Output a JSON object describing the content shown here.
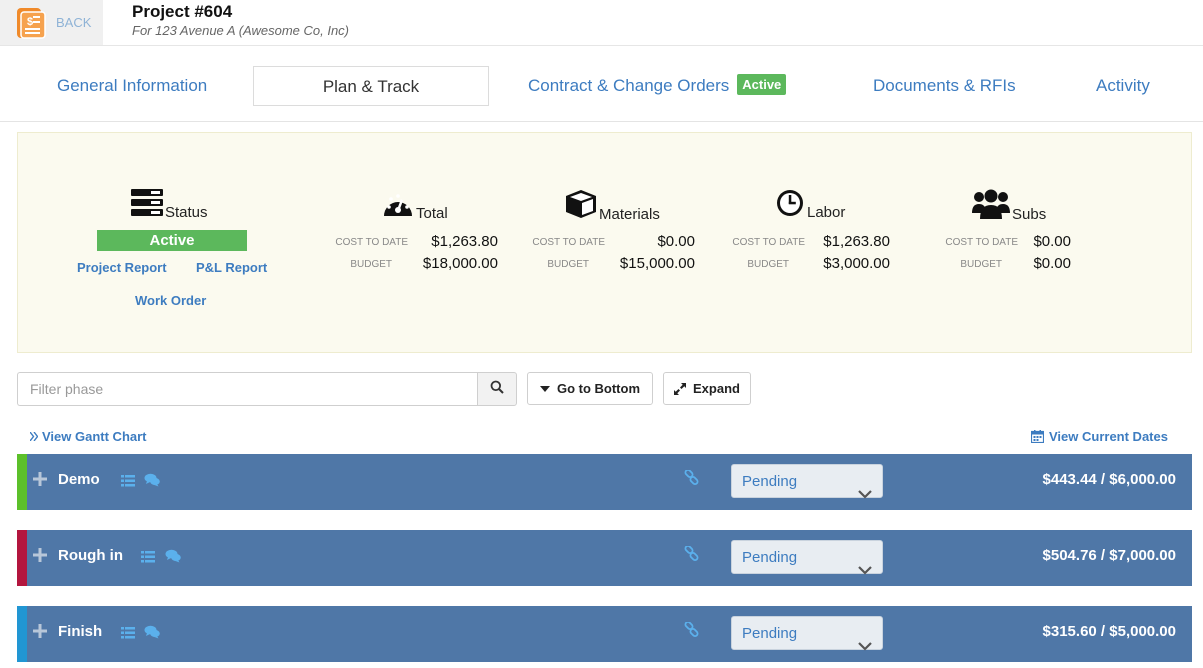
{
  "header": {
    "back_label": "BACK",
    "project_title": "Project #604",
    "project_subtitle": "For 123 Avenue A (Awesome Co, Inc)"
  },
  "tabs": [
    {
      "label": "General Information"
    },
    {
      "label": "Plan & Track"
    },
    {
      "label": "Contract & Change Orders",
      "badge": "Active"
    },
    {
      "label": "Documents & RFIs"
    },
    {
      "label": "Activity"
    }
  ],
  "summary": {
    "status": {
      "heading": "Status",
      "value": "Active",
      "links": [
        "Project Report",
        "P&L Report",
        "Work Order"
      ]
    },
    "cost_to_date_label": "COST TO DATE",
    "budget_label": "BUDGET",
    "stats": [
      {
        "name": "Total",
        "icon": "dashboard-icon",
        "cost_to_date": "$1,263.80",
        "budget": "$18,000.00"
      },
      {
        "name": "Materials",
        "icon": "cube-icon",
        "cost_to_date": "$0.00",
        "budget": "$15,000.00"
      },
      {
        "name": "Labor",
        "icon": "clock-icon",
        "cost_to_date": "$1,263.80",
        "budget": "$3,000.00"
      },
      {
        "name": "Subs",
        "icon": "users-icon",
        "cost_to_date": "$0.00",
        "budget": "$0.00"
      }
    ]
  },
  "toolbar": {
    "filter_placeholder": "Filter phase",
    "go_to_bottom_label": "Go to Bottom",
    "expand_label": "Expand",
    "view_gantt_label": "View Gantt Chart",
    "view_dates_label": "View Current Dates"
  },
  "phases": [
    {
      "name": "Demo",
      "status": "Pending",
      "amount": "$443.44 / $6,000.00",
      "color": "#5cc02a"
    },
    {
      "name": "Rough in",
      "status": "Pending",
      "amount": "$504.76 / $7,000.00",
      "color": "#b3163e"
    },
    {
      "name": "Finish",
      "status": "Pending",
      "amount": "$315.60 / $5,000.00",
      "color": "#2196d3"
    }
  ],
  "colors": {
    "accent": "#3d7cc0",
    "active_green": "#5cb85c",
    "phase_bar": "#4f77a7",
    "summary_bg": "#fbfaef"
  }
}
